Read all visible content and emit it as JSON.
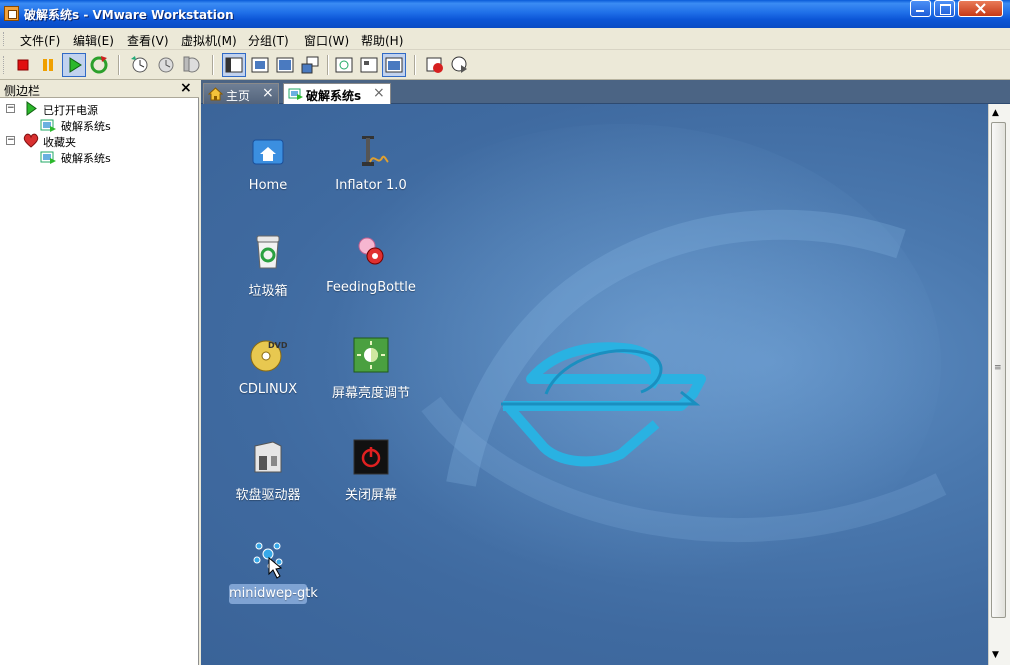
{
  "window": {
    "title": "破解系统s - VMware Workstation"
  },
  "menu": [
    "文件(F)",
    "编辑(E)",
    "查看(V)",
    "虚拟机(M)",
    "分组(T)",
    "窗口(W)",
    "帮助(H)"
  ],
  "toolbar": {
    "buttons": [
      "stop-icon",
      "pause-icon",
      "play-icon",
      "reset-icon",
      "snapshot-icon",
      "revert-snapshot-icon",
      "snapshot-manager-icon",
      "sidebar-toggle-icon",
      "quick-switch-icon",
      "full-screen-icon",
      "unity-icon",
      "summary-icon",
      "console-icon",
      "appliance-view-icon",
      "record-icon",
      "replay-icon"
    ]
  },
  "sidebar": {
    "title": "侧边栏",
    "close": "×",
    "groups": [
      {
        "label": "已打开电源",
        "icon": "power-on-icon",
        "items": [
          "破解系统s"
        ]
      },
      {
        "label": "收藏夹",
        "icon": "favorites-heart-icon",
        "items": [
          "破解系统s"
        ]
      }
    ]
  },
  "tabs": [
    {
      "label": "主页",
      "icon": "home-icon",
      "close": "×",
      "active": false
    },
    {
      "label": "破解系统s",
      "icon": "vm-icon",
      "close": "×",
      "active": true
    }
  ],
  "desktop": {
    "icons": [
      {
        "label": "Home",
        "icon": "home-folder-icon"
      },
      {
        "label": "Inflator 1.0",
        "icon": "inflator-pump-icon"
      },
      {
        "label": "垃圾箱",
        "icon": "trash-icon"
      },
      {
        "label": "FeedingBottle",
        "icon": "feeding-bottle-icon"
      },
      {
        "label": "CDLINUX",
        "icon": "dvd-icon"
      },
      {
        "label": "屏幕亮度调节",
        "icon": "brightness-icon"
      },
      {
        "label": "软盘驱动器",
        "icon": "floppy-drive-icon"
      },
      {
        "label": "关闭屏幕",
        "icon": "screen-off-icon"
      },
      {
        "label": "minidwep-gtk",
        "icon": "minidwep-icon",
        "selected": true
      }
    ]
  },
  "colors": {
    "titlebar": "#0c55d6",
    "desktop": "#4a78ae",
    "logo": "#2fb2e0"
  }
}
